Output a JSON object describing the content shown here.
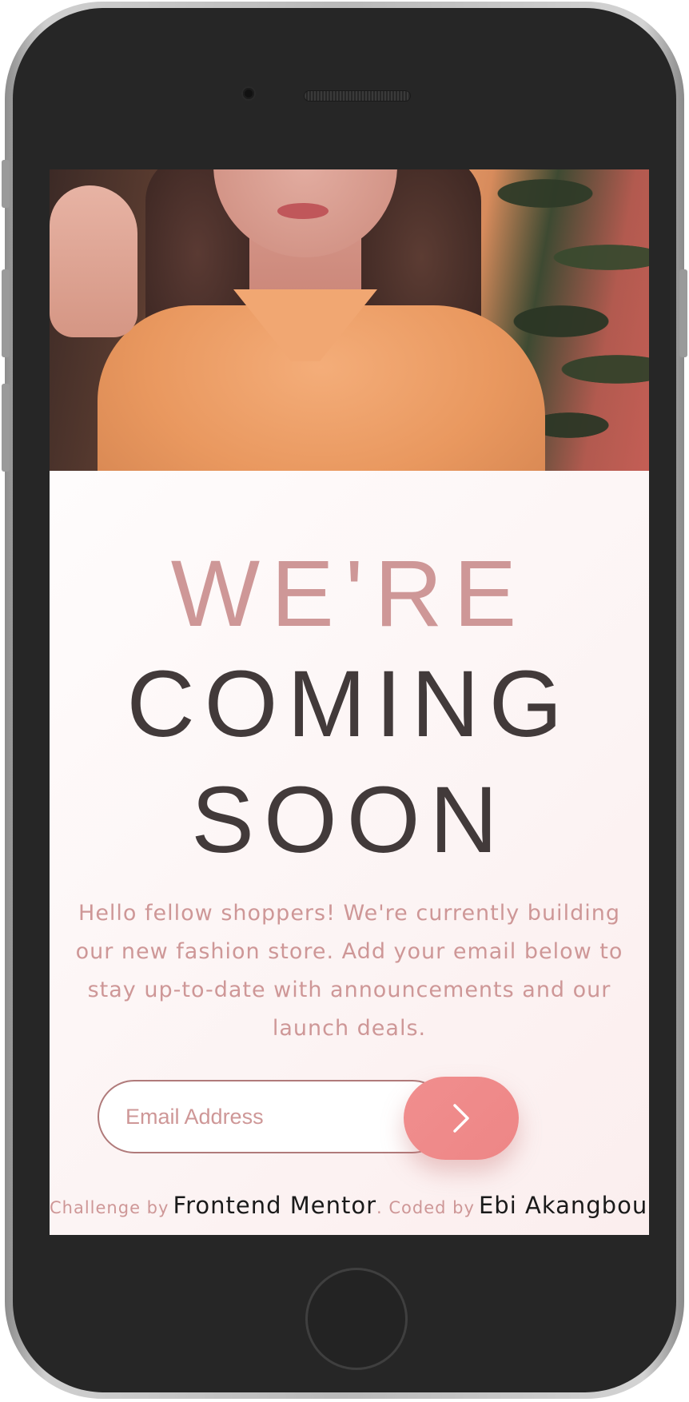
{
  "heading": {
    "line1": "WE'RE",
    "line2": "COMING",
    "line3": "SOON"
  },
  "description": "Hello fellow shoppers! We're currently building our new fashion store. Add your email below to stay up-to-date with announcements and our launch deals.",
  "form": {
    "email_placeholder": "Email Address",
    "submit_icon": "chevron-right-icon"
  },
  "footer": {
    "challenge_prefix": "Challenge by",
    "challenge_link": "Frontend Mentor",
    "coded_prefix": ". Coded by",
    "author_link": "Ebi Akangbou",
    "suffix": "."
  },
  "colors": {
    "accent_light": "#ce9797",
    "heading_dark": "#423a3a",
    "button": "#f08e8e",
    "background_end": "#fbeeee"
  }
}
